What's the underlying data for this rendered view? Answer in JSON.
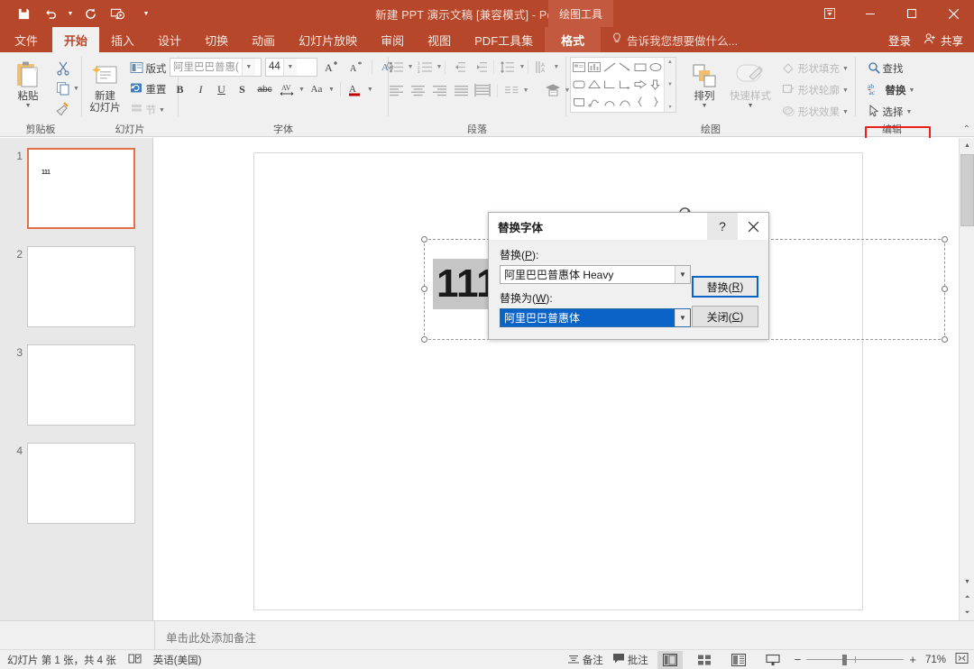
{
  "titlebar": {
    "document_title": "新建 PPT 演示文稿 [兼容模式] - PowerPoint",
    "contextual_group": "绘图工具",
    "qat": [
      {
        "name": "save",
        "icon": "save-icon"
      },
      {
        "name": "undo",
        "icon": "undo-icon"
      },
      {
        "name": "redo",
        "icon": "redo-icon"
      },
      {
        "name": "start-slideshow",
        "icon": "slideshow-icon"
      },
      {
        "name": "customize-qat",
        "icon": "chevron-down-icon"
      }
    ],
    "window_controls": {
      "ribbon_display": "⊼",
      "minimize": "—",
      "maximize": "▢",
      "close": "✕"
    }
  },
  "tabs": [
    {
      "label": "文件",
      "active": false,
      "kind": "file"
    },
    {
      "label": "开始",
      "active": true,
      "kind": "normal"
    },
    {
      "label": "插入",
      "active": false,
      "kind": "normal"
    },
    {
      "label": "设计",
      "active": false,
      "kind": "normal"
    },
    {
      "label": "切换",
      "active": false,
      "kind": "normal"
    },
    {
      "label": "动画",
      "active": false,
      "kind": "normal"
    },
    {
      "label": "幻灯片放映",
      "active": false,
      "kind": "normal"
    },
    {
      "label": "审阅",
      "active": false,
      "kind": "normal"
    },
    {
      "label": "视图",
      "active": false,
      "kind": "normal"
    },
    {
      "label": "PDF工具集",
      "active": false,
      "kind": "normal"
    },
    {
      "label": "格式",
      "active": false,
      "kind": "contextual"
    }
  ],
  "tell_me_placeholder": "告诉我您想要做什么...",
  "account": {
    "sign_in": "登录",
    "share": "共享"
  },
  "ribbon": {
    "groups": [
      {
        "name": "clipboard",
        "label": "剪贴板",
        "paste_label": "粘贴",
        "items": [
          "剪切",
          "复制",
          "格式刷"
        ]
      },
      {
        "name": "slides",
        "label": "幻灯片",
        "new_slide_label": "新建\n幻灯片",
        "layout_label": "版式",
        "reset_label": "重置",
        "section_label": "节"
      },
      {
        "name": "font",
        "label": "字体",
        "font_name": "阿里巴巴普惠(",
        "font_size": "44",
        "buttons": [
          "B",
          "I",
          "U",
          "S",
          "abc",
          "AV",
          "Aa",
          "A"
        ]
      },
      {
        "name": "paragraph",
        "label": "段落"
      },
      {
        "name": "drawing",
        "label": "绘图",
        "arrange_label": "排列",
        "quickstyles_label": "快速样式",
        "shape_fill": "形状填充",
        "shape_outline": "形状轮廓",
        "shape_effects": "形状效果"
      },
      {
        "name": "editing",
        "label": "编辑",
        "find_label": "查找",
        "replace_label": "替换",
        "select_label": "选择"
      }
    ]
  },
  "thumbnails": [
    {
      "number": "1",
      "selected": true,
      "text": "111"
    },
    {
      "number": "2",
      "selected": false,
      "text": ""
    },
    {
      "number": "3",
      "selected": false,
      "text": ""
    },
    {
      "number": "4",
      "selected": false,
      "text": ""
    }
  ],
  "slide": {
    "textbox_value": "111"
  },
  "notes": {
    "placeholder": "单击此处添加备注"
  },
  "statusbar": {
    "slide_info": "幻灯片 第 1 张，共 4 张",
    "language": "英语(美国)",
    "notes_button": "备注",
    "comments_button": "批注",
    "zoom_level": "71%"
  },
  "dialog": {
    "title": "替换字体",
    "help_glyph": "?",
    "close_glyph": "✕",
    "replace_label_pre": "替换(",
    "replace_label_key": "P",
    "replace_label_post": "):",
    "replace_value": "阿里巴巴普惠体 Heavy",
    "with_label_pre": "替换为(",
    "with_label_key": "W",
    "with_label_post": "):",
    "with_value": "阿里巴巴普惠体",
    "replace_button_pre": "替换(",
    "replace_button_key": "R",
    "replace_button_post": ")",
    "close_button_pre": "关闭(",
    "close_button_key": "C",
    "close_button_post": ")"
  },
  "colors": {
    "brand": "#b7472a",
    "contextual": "#c3593e",
    "highlight_box": "#e8201a",
    "selection_blue": "#0a64c8",
    "thumb_selected_border": "#e2704a"
  }
}
